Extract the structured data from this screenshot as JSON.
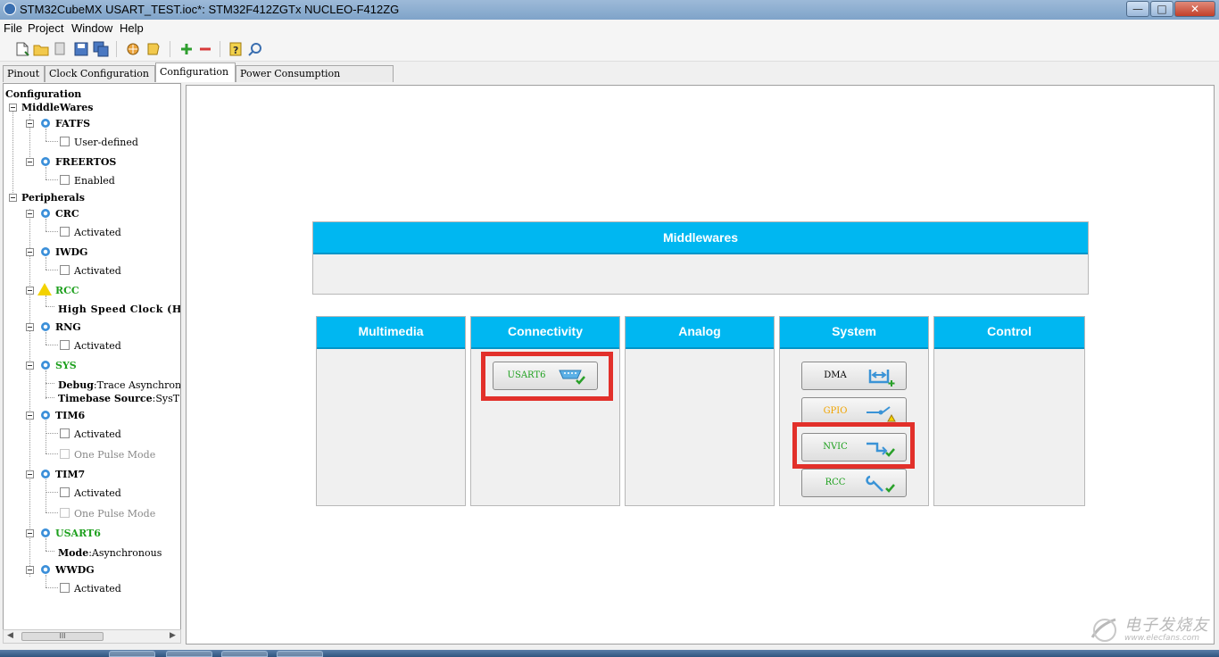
{
  "window": {
    "title": "STM32CubeMX USART_TEST.ioc*: STM32F412ZGTx NUCLEO-F412ZG"
  },
  "menu": [
    "File",
    "Project",
    "Window",
    "Help"
  ],
  "tabs": [
    {
      "label": "Pinout",
      "active": false
    },
    {
      "label": "Clock Configuration",
      "active": false
    },
    {
      "label": "Configuration",
      "active": true
    },
    {
      "label": "Power Consumption Calculator",
      "active": false
    }
  ],
  "tree": {
    "root": "Configuration",
    "middlewares": {
      "label": "MiddleWares",
      "fatfs": {
        "label": "FATFS",
        "child": "User-defined"
      },
      "freertos": {
        "label": "FREERTOS",
        "child": "Enabled"
      }
    },
    "peripherals": {
      "label": "Peripherals",
      "crc": {
        "label": "CRC",
        "child": "Activated"
      },
      "iwdg": {
        "label": "IWDG",
        "child": "Activated"
      },
      "rcc": {
        "label": "RCC",
        "child": "High Speed Clock (HS"
      },
      "rng": {
        "label": "RNG",
        "child": "Activated"
      },
      "sys": {
        "label": "SYS",
        "debug_key": "Debug",
        "debug_val": ":Trace Asynchrono",
        "tb_key": "Timebase Source",
        "tb_val": ":SysT"
      },
      "tim6": {
        "label": "TIM6",
        "child1": "Activated",
        "child2": "One Pulse Mode"
      },
      "tim7": {
        "label": "TIM7",
        "child1": "Activated",
        "child2": "One Pulse Mode"
      },
      "usart6": {
        "label": "USART6",
        "mode_key": "Mode",
        "mode_val": ":Asynchronous"
      },
      "wwdg": {
        "label": "WWDG",
        "child": "Activated"
      }
    }
  },
  "scrollbar": {
    "thumb": "III"
  },
  "main": {
    "middlewares": "Middlewares",
    "categories": [
      "Multimedia",
      "Connectivity",
      "Analog",
      "System",
      "Control"
    ],
    "connectivity_buttons": [
      {
        "label": "USART6",
        "icon": "serial-port-check-icon"
      }
    ],
    "system_buttons": [
      {
        "label": "DMA",
        "icon": "dma-plus-icon"
      },
      {
        "label": "GPIO",
        "icon": "gpio-warning-icon"
      },
      {
        "label": "NVIC",
        "icon": "nvic-check-icon"
      },
      {
        "label": "RCC",
        "icon": "wrench-check-icon"
      }
    ]
  },
  "watermark": {
    "text": "电子发烧友",
    "url": "www.elecfans.com"
  },
  "colors": {
    "header": "#00b7f1",
    "highlight": "#e2302a",
    "ok_green": "#1ea01e",
    "warn": "#f3d200"
  }
}
